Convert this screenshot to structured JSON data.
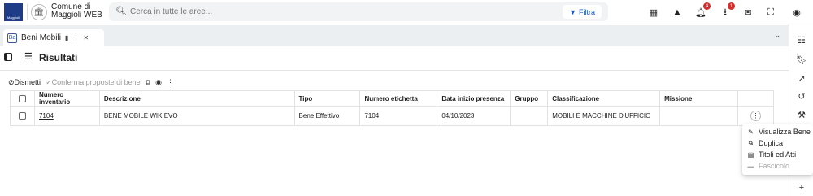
{
  "header": {
    "logo_text": "Maggioli",
    "org_name": "Comune di Maggioli WEB",
    "search_placeholder": "Cerca in tutte le aree...",
    "filter_label": "Filtra",
    "notifications": {
      "bell_count": "4",
      "download_count": "1"
    }
  },
  "tabs": [
    {
      "icon_text": "Ba",
      "label": "Beni Mobili"
    }
  ],
  "section": {
    "title": "Risultati"
  },
  "toolbar": {
    "dismetti_label": "Dismetti",
    "conferma_label": "Conferma proposte di bene"
  },
  "table": {
    "columns": [
      "Numero inventario",
      "Descrizione",
      "Tipo",
      "Numero etichetta",
      "Data inizio presenza",
      "Gruppo",
      "Classificazione",
      "Missione"
    ],
    "rows": [
      {
        "numero_inventario": "7104",
        "descrizione": "BENE MOBILE WIKIEVO",
        "tipo": "Bene Effettivo",
        "numero_etichetta": "7104",
        "data_inizio": "04/10/2023",
        "gruppo": "",
        "classificazione": "MOBILI E MACCHINE D'UFFICIO",
        "missione": ""
      }
    ]
  },
  "context_menu": [
    {
      "label": "Visualizza Bene",
      "icon": "pencil-icon",
      "disabled": false
    },
    {
      "label": "Duplica",
      "icon": "copy-icon",
      "disabled": false
    },
    {
      "label": "Titoli ed Atti",
      "icon": "document-icon",
      "disabled": false
    },
    {
      "label": "Fascicolo",
      "icon": "folder-icon",
      "disabled": true
    }
  ],
  "colors": {
    "accent": "#1a56c6",
    "badge": "#d32f2f",
    "logo_bg": "#1f3c88"
  }
}
